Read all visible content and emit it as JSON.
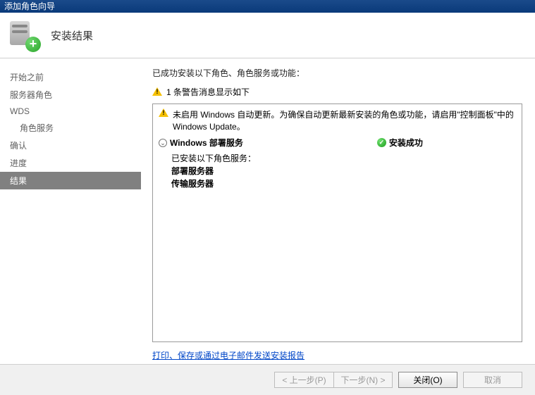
{
  "titlebar": {
    "title": "添加角色向导"
  },
  "header": {
    "title": "安装结果"
  },
  "sidebar": {
    "items": [
      {
        "label": "开始之前",
        "indent": false,
        "active": false
      },
      {
        "label": "服务器角色",
        "indent": false,
        "active": false
      },
      {
        "label": "WDS",
        "indent": false,
        "active": false
      },
      {
        "label": "角色服务",
        "indent": true,
        "active": false
      },
      {
        "label": "确认",
        "indent": false,
        "active": false
      },
      {
        "label": "进度",
        "indent": false,
        "active": false
      },
      {
        "label": "结果",
        "indent": false,
        "active": true
      }
    ]
  },
  "main": {
    "summary": "已成功安装以下角色、角色服务或功能：",
    "warn_count_line": "1 条警告消息显示如下",
    "frame": {
      "auto_update_warning": "未启用 Windows 自动更新。为确保自动更新最新安装的角色或功能，请启用\"控制面板\"中的 Windows Update。",
      "role": {
        "name": "Windows 部署服务",
        "status_label": "安装成功"
      },
      "installed_heading": "已安装以下角色服务：",
      "services": [
        "部署服务器",
        "传输服务器"
      ]
    },
    "report_link": "打印、保存或通过电子邮件发送安装报告"
  },
  "buttons": {
    "back": "< 上一步(P)",
    "next": "下一步(N) >",
    "close": "关闭(O)",
    "cancel": "取消"
  }
}
